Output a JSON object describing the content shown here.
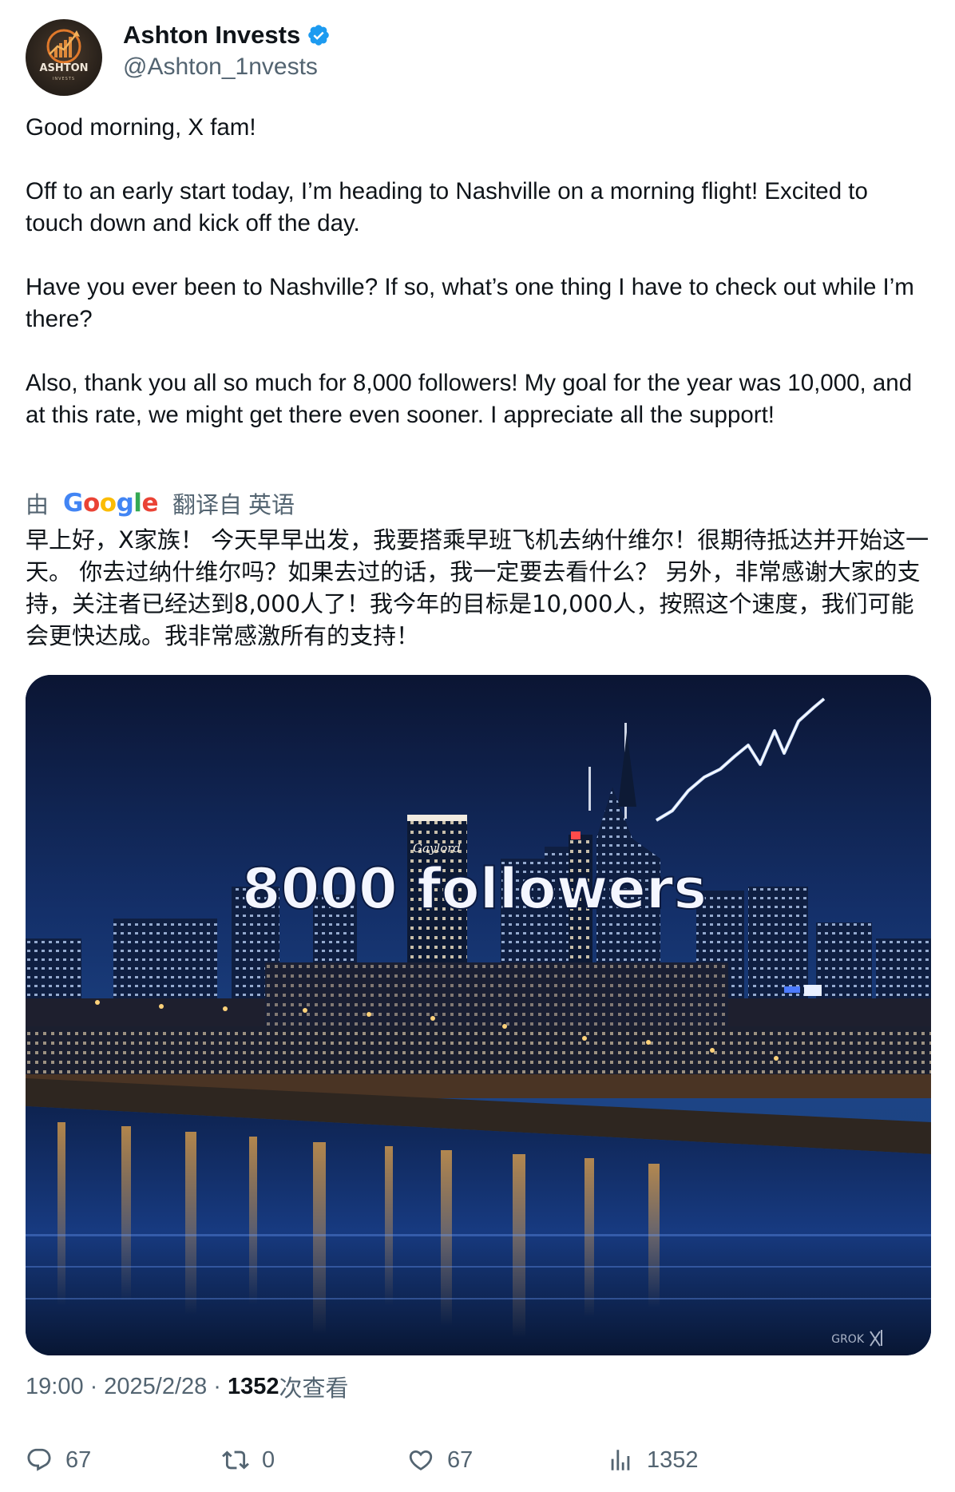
{
  "author": {
    "display_name": "Ashton Invests",
    "handle": "@Ashton_1nvests",
    "avatar_text": "ASHTON",
    "avatar_subtext": "INVESTS",
    "verified": true
  },
  "tweet": {
    "paragraphs": [
      "Good morning, X fam!",
      "Off to an early start today, I’m heading to Nashville on a morning flight! Excited to touch down and kick off the day.",
      "Have you ever been to Nashville? If so, what’s one thing I have to check out while I’m there?",
      "Also, thank you all so much for 8,000 followers! My goal for the year was 10,000, and at this rate, we might get there even sooner. I appreciate all the support!"
    ]
  },
  "translation": {
    "by_label": "由",
    "provider": "Google",
    "from_label": "翻译自 英语",
    "text": "早上好，X家族！ 今天早早出发，我要搭乘早班飞机去纳什维尔！很期待抵达并开始这一天。 你去过纳什维尔吗？如果去过的话，我一定要去看什么？ 另外，非常感谢大家的支持，关注者已经达到8,000人了！我今年的目标是10,000人，按照这个速度，我们可能会更快达成。我非常感激所有的支持！"
  },
  "media": {
    "overlay_text": "8000 followers",
    "watermark": "GROK",
    "sign_text": "Gaylord"
  },
  "meta": {
    "time": "19:00",
    "separator": "·",
    "date": "2025/2/28",
    "views_count": "1352",
    "views_label": "次查看"
  },
  "actions": {
    "replies": "67",
    "reposts": "0",
    "likes": "67",
    "views": "1352"
  },
  "colors": {
    "text_primary": "#0f1419",
    "text_secondary": "#536471",
    "verified_blue": "#1d9bf0"
  }
}
